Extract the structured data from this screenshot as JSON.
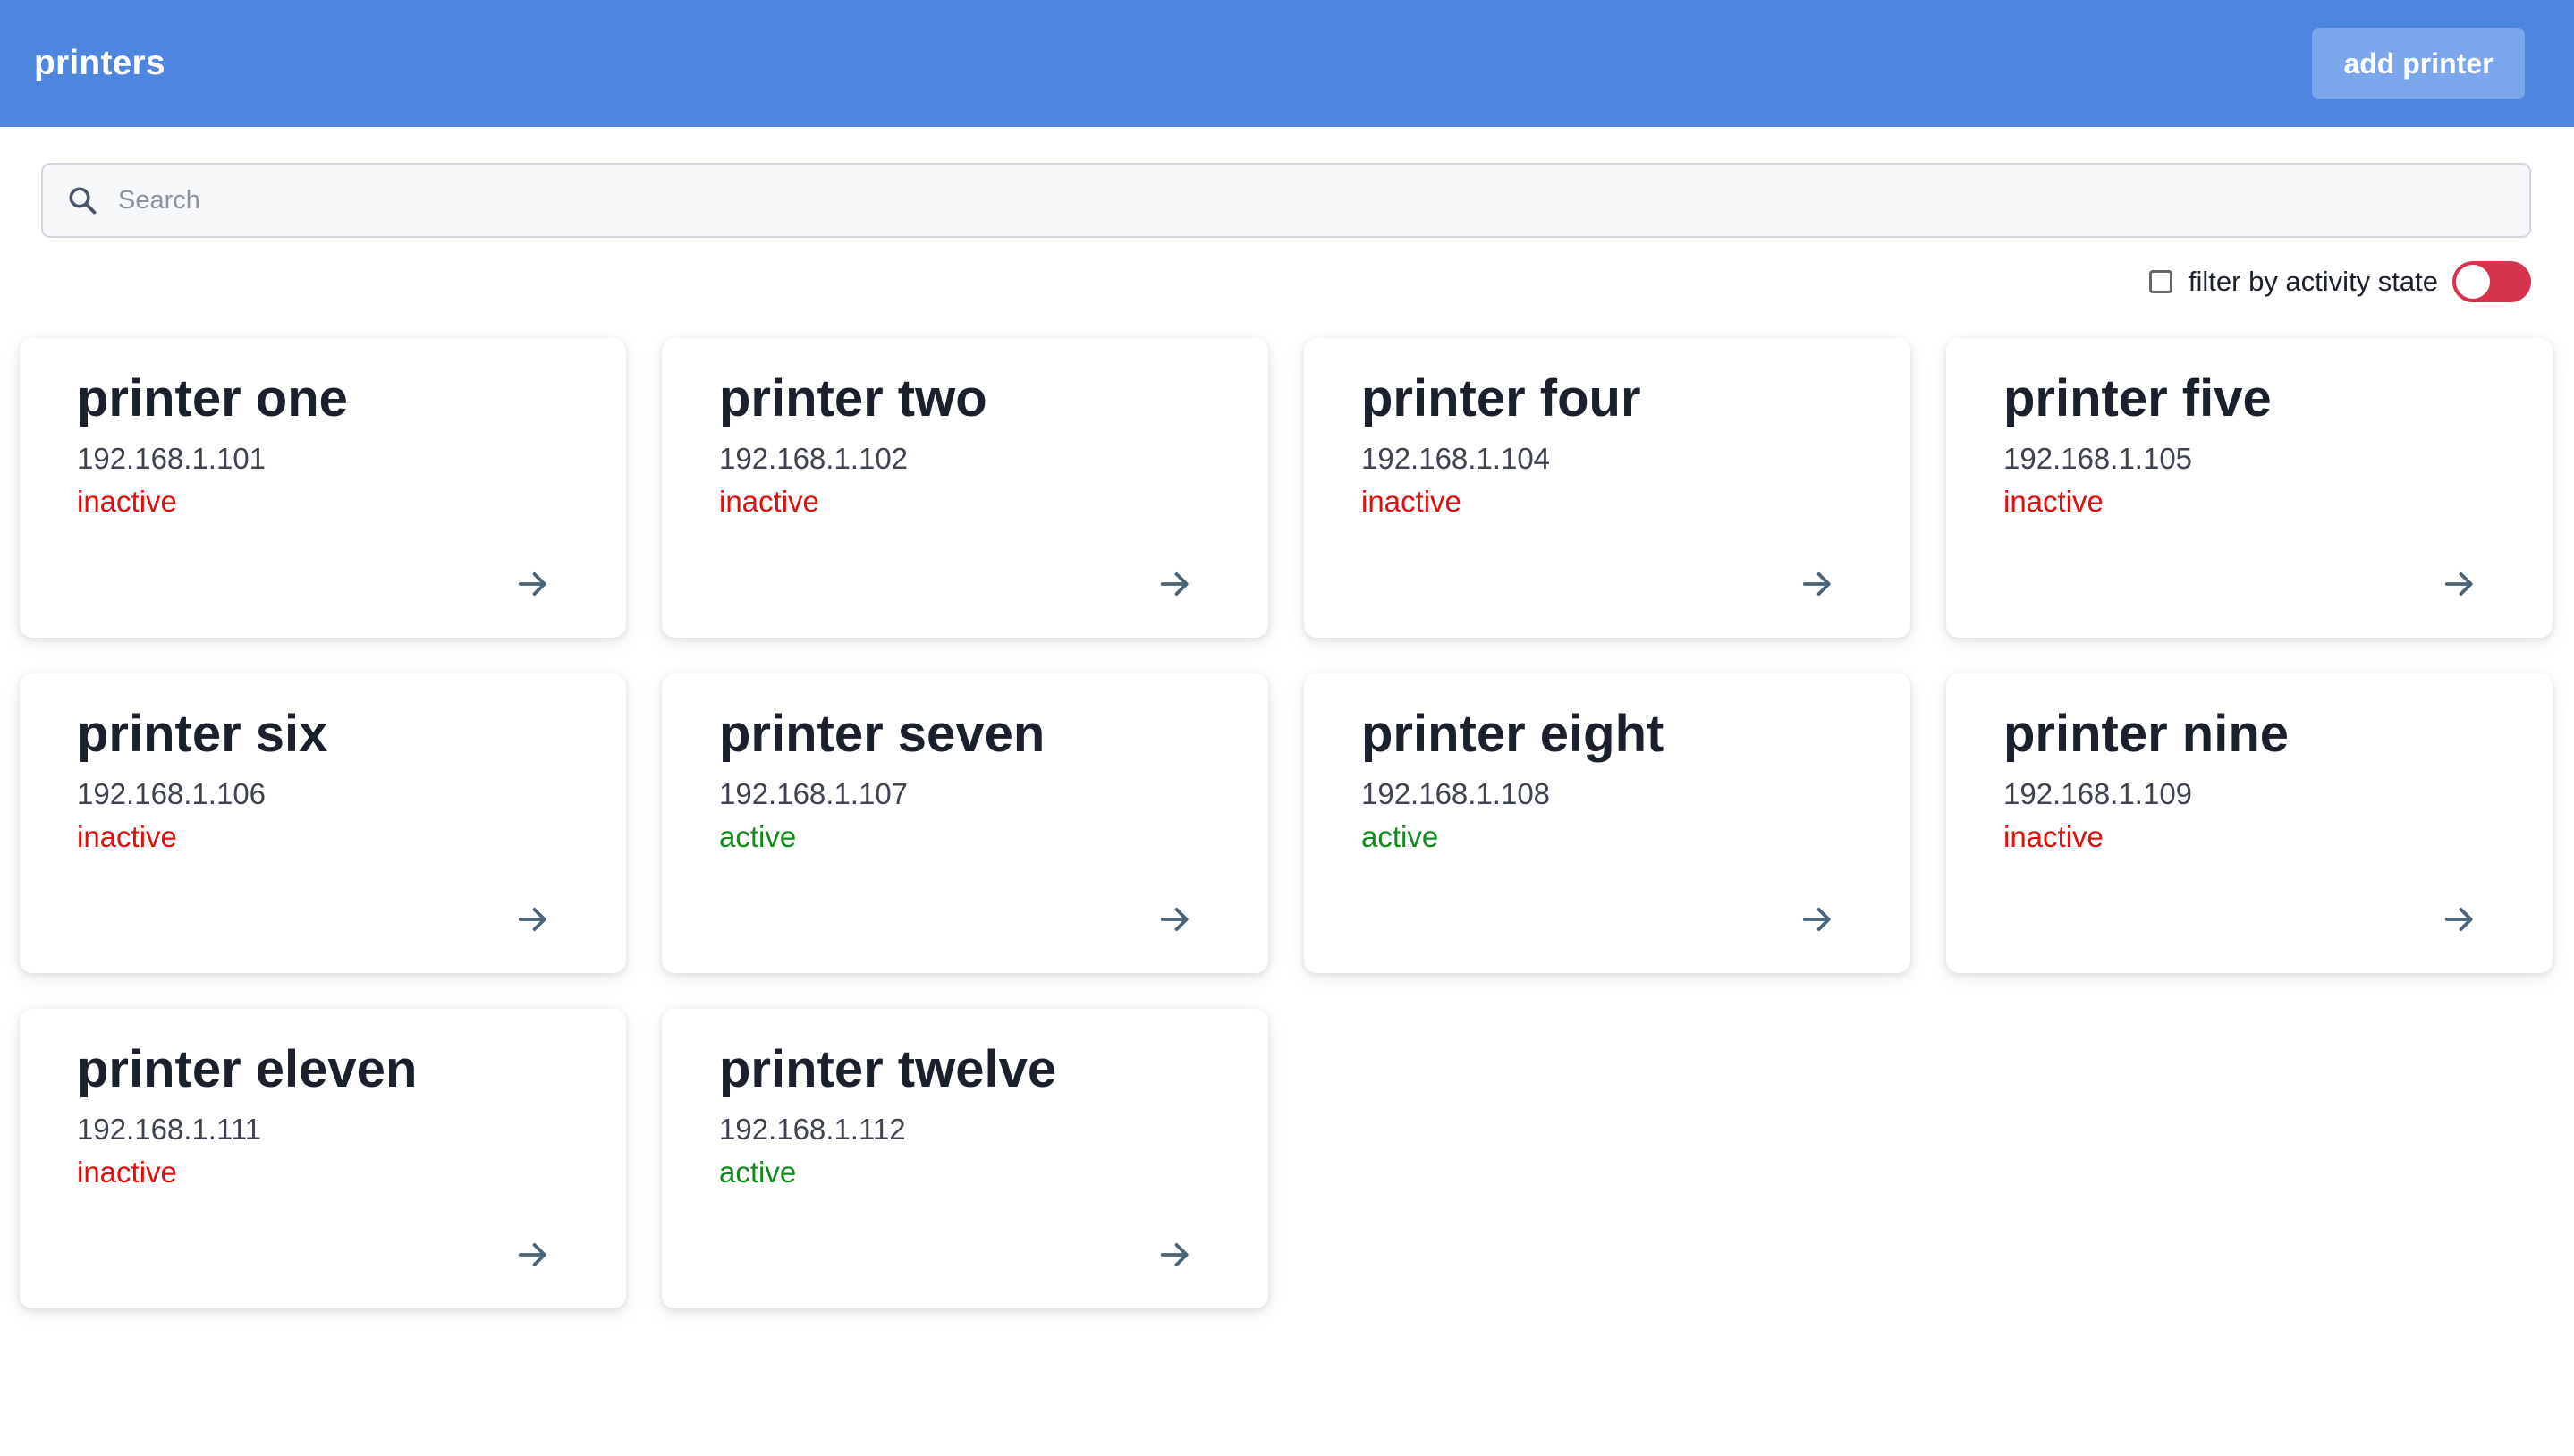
{
  "header": {
    "title": "printers",
    "add_button_label": "add printer"
  },
  "search": {
    "placeholder": "Search",
    "value": ""
  },
  "filter": {
    "label": "filter by activity state",
    "checked": false,
    "toggle_on": false
  },
  "colors": {
    "header_bg": "#4d86df",
    "button_bg": "#7aa7ec",
    "inactive": "#e10e0e",
    "active": "#12891c",
    "toggle": "#d6334f",
    "arrow": "#4a6379"
  },
  "printers": [
    {
      "name": "printer one",
      "ip": "192.168.1.101",
      "status": "inactive"
    },
    {
      "name": "printer two",
      "ip": "192.168.1.102",
      "status": "inactive"
    },
    {
      "name": "printer four",
      "ip": "192.168.1.104",
      "status": "inactive"
    },
    {
      "name": "printer five",
      "ip": "192.168.1.105",
      "status": "inactive"
    },
    {
      "name": "printer six",
      "ip": "192.168.1.106",
      "status": "inactive"
    },
    {
      "name": "printer seven",
      "ip": "192.168.1.107",
      "status": "active"
    },
    {
      "name": "printer eight",
      "ip": "192.168.1.108",
      "status": "active"
    },
    {
      "name": "printer nine",
      "ip": "192.168.1.109",
      "status": "inactive"
    },
    {
      "name": "printer eleven",
      "ip": "192.168.1.111",
      "status": "inactive"
    },
    {
      "name": "printer twelve",
      "ip": "192.168.1.112",
      "status": "active"
    }
  ]
}
